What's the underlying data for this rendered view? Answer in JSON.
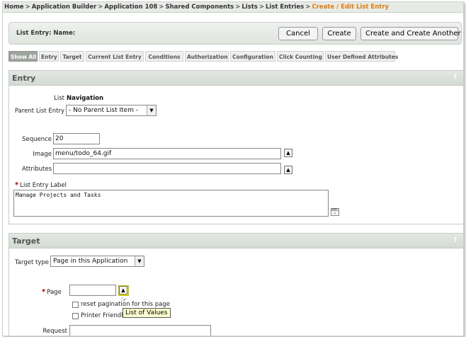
{
  "breadcrumb": {
    "items": [
      "Home",
      "Application Builder",
      "Application 108",
      "Shared Components",
      "Lists",
      "List Entries"
    ],
    "separator": ">",
    "current": "Create / Edit List Entry"
  },
  "header": {
    "title": "List Entry:  Name:",
    "cancel_label": "Cancel",
    "create_label": "Create",
    "create_another_label": "Create and Create Another"
  },
  "tabs": [
    {
      "label": "Show All",
      "active": true
    },
    {
      "label": "Entry"
    },
    {
      "label": "Target"
    },
    {
      "label": "Current List Entry"
    },
    {
      "label": "Conditions"
    },
    {
      "label": "Authorization"
    },
    {
      "label": "Configuration"
    },
    {
      "label": "Click Counting"
    },
    {
      "label": "User Defined Attributes"
    }
  ],
  "entry": {
    "title": "Entry",
    "list_label": "List",
    "list_value": "Navigation",
    "parent_label": "Parent List Entry",
    "parent_value": "- No Parent List Item -",
    "sequence_label": "Sequence",
    "sequence_value": "20",
    "image_label": "Image",
    "image_value": "menu/todo_64.gif",
    "attributes_label": "Attributes",
    "attributes_value": "",
    "label_label": "List Entry Label",
    "label_value": "Manage Projects and Tasks"
  },
  "target": {
    "title": "Target",
    "type_label": "Target type",
    "type_value": "Page in this Application",
    "page_label": "Page",
    "page_value": "",
    "reset_label": "reset pagination for this page",
    "printer_label": "Printer Friendl",
    "request_label": "Request",
    "request_value": "",
    "tooltip": "List of Values"
  },
  "colors": {
    "breadcrumb_current": "#e07a10",
    "required_star": "#b00000",
    "tooltip_bg": "#ffffd0",
    "highlight": "#f2f20a"
  }
}
